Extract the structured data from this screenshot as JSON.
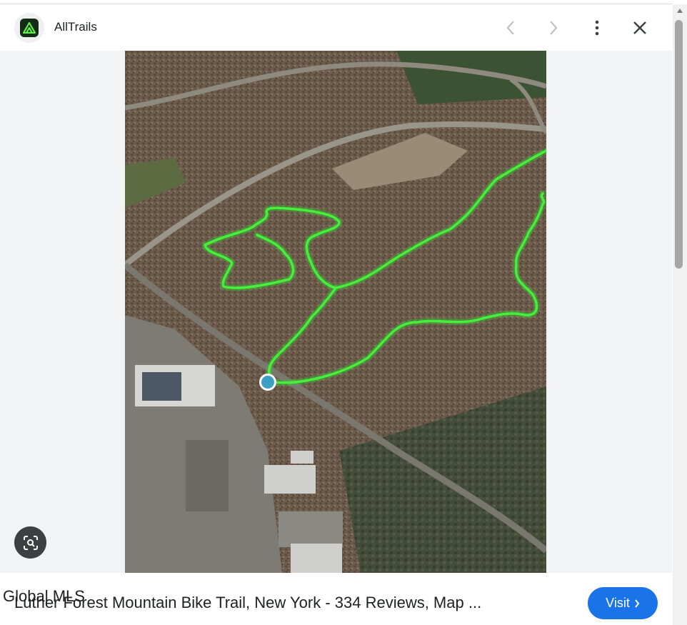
{
  "header": {
    "site_name": "AllTrails",
    "logo_icon": "alltrails-logo-icon",
    "prev_icon": "chevron-left-icon",
    "next_icon": "chevron-right-icon",
    "more_icon": "more-vert-icon",
    "close_icon": "close-icon"
  },
  "image": {
    "description_icon": "map-image",
    "trail_color": "#3ee03a",
    "marker_color": "#3b9ec4"
  },
  "lens": {
    "icon": "lens-search-icon"
  },
  "footer": {
    "watermark": "Global MLS",
    "caption": "Luther Forest Mountain Bike Trail, New York - 334 Reviews, Map ...",
    "visit_label": "Visit",
    "visit_icon": "chevron-right-icon",
    "accent": "#1a73e8"
  }
}
